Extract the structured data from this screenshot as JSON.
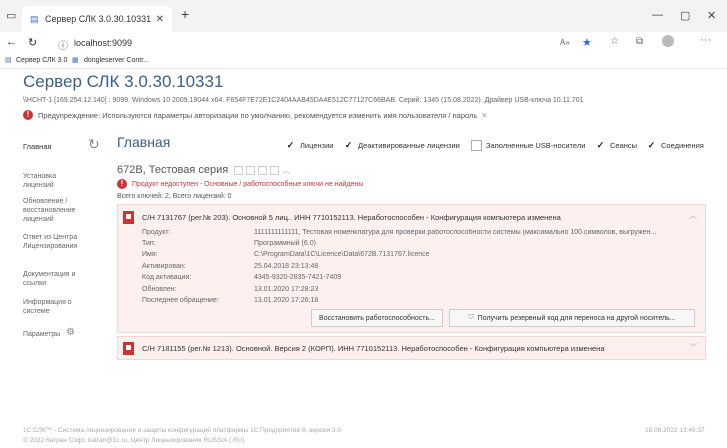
{
  "browser": {
    "tab_title": "Сервер СЛК 3.0.30.10331",
    "address": "localhost:9099",
    "bookmarks": [
      "Сервер СЛК 3.0",
      "dongleserver Contr..."
    ]
  },
  "header": {
    "title": "Сервер СЛК 3.0.30.10331",
    "subtitle": "\\\\HCHT-1 [169.254.12.140] : 9099.  Windows 10 2009.19044 x64.  F654F7E72E1C2404AAB45DA4E512C77127C66BAB.  Серий: 1345 (15.08.2022).  Драйвер USB-ключа 10.11.701",
    "warning": "Предупреждение: Используются параметры авторизации по умолчанию, рекомендуется изменить имя пользователя / пароль"
  },
  "sidebar": {
    "active": "Главная",
    "items": [
      "Установка лицензий",
      "Обновление / восстановление лицензий",
      "Ответ из Центра Лицензирования",
      "Документация и ссылки",
      "Информация о системе",
      "Параметры"
    ]
  },
  "main": {
    "title": "Главная",
    "filters": [
      {
        "label": "Лицензии",
        "checked": true
      },
      {
        "label": "Деактивированные лицензии",
        "checked": true
      },
      {
        "label": "Заполненные USB-носители",
        "checked": false
      },
      {
        "label": "Сеансы",
        "checked": true
      },
      {
        "label": "Соединения",
        "checked": true
      }
    ],
    "series_title": "672B, Тестовая серия",
    "error": "Продукт недоступен - Основные / работоспособные ключи не найдены",
    "counts": "Всего ключей: 2,  Всего лицензий: 0",
    "license1": {
      "header": "С/Н 7131767 (рег.№ 203).  Основной 5 лиц..  ИНН 7710152113.  Неработоспособен - Конфигурация компьютера изменена",
      "fields": [
        {
          "k": "Продукт:",
          "v": "1111111111111, Тестовая номенклатура для проверки работоспособности системы (максимально 100 символов, выгружен..."
        },
        {
          "k": "Тип:",
          "v": "Программный (6.0)"
        },
        {
          "k": "Имя:",
          "v": "C:\\ProgramData\\1C\\Licence\\Data\\672B.7131767.licence"
        },
        {
          "k": "Активирован:",
          "v": "25.04.2018 23:13:48"
        },
        {
          "k": "Код активации:",
          "v": "4345-9320-2835-7421-7409"
        },
        {
          "k": "Обновлен:",
          "v": "13.01.2020 17:28:23"
        },
        {
          "k": "Последнее обращение:",
          "v": "13.01.2020 17:26:18"
        }
      ],
      "btn_restore": "Восстановить работоспособность...",
      "btn_backup": "Получить резервный код для переноса на другой носитель..."
    },
    "license2": {
      "header": "С/Н 7181155 (рег.№ 1213).  Основной.  Версия 2 (КОРП).  ИНН 7710152113.  Неработоспособен - Конфигурация компьютера изменена"
    }
  },
  "footer": {
    "line1": "1С:СЛК™ - Система лицензирования и защиты конфигураций платформы 1С:Предприятие 8, версия 3.0",
    "line2": "© 2022 Катран Софт. katran@1c.ru. Центр Лицензирования RUSSIA (.RU)",
    "timestamp": "18.08.2022 13:49:37"
  }
}
